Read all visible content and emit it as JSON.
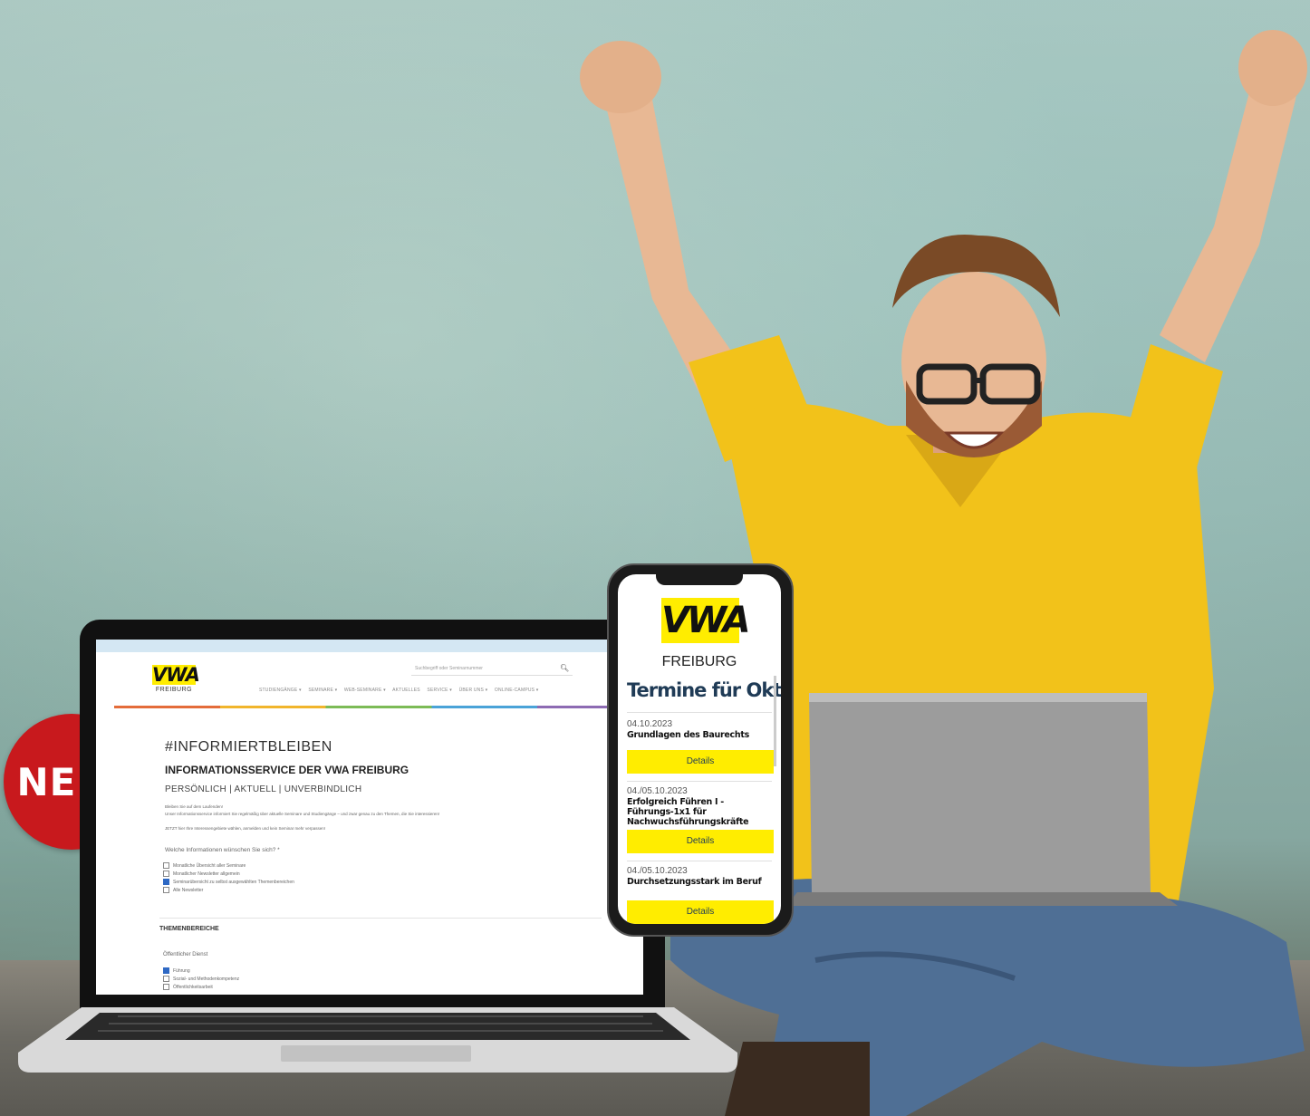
{
  "badge": {
    "text": "NEU!"
  },
  "laptop_site": {
    "logo_mark": "VWA",
    "logo_city": "FREIBURG",
    "search_placeholder": "Suchbegriff oder Seminarnummer",
    "nav": [
      "STUDIENGÄNGE ▾",
      "SEMINARE ▾",
      "WEB-SEMINARE ▾",
      "AKTUELLES",
      "SERVICE ▾",
      "ÜBER UNS ▾",
      "ONLINE-CAMPUS ▾"
    ],
    "hashtag": "#INFORMIERTBLEIBEN",
    "heading": "INFORMATIONSSERVICE DER VWA FREIBURG",
    "subheading": "PERSÖNLICH | AKTUELL | UNVERBINDLICH",
    "paragraphs": [
      "Bleiben Sie auf dem Laufenden!",
      "Unser Informationsservice informiert Sie regelmäßig über aktuelle Seminare und Studiengänge – und zwar genau zu den Themen, die Sie interessieren!",
      "JETZT hier Ihre Interessengebiete wählen, anmelden und kein Seminar mehr verpassen!"
    ],
    "question": "Welche Informationen wünschen Sie sich? *",
    "options": [
      {
        "label": "Monatliche Übersicht aller Seminare",
        "checked": false
      },
      {
        "label": "Monatlicher Newsletter allgemein",
        "checked": false
      },
      {
        "label": "Seminarübersicht zu selbst ausgewählten Themenbereichen",
        "checked": true
      },
      {
        "label": "Alle Newsletter",
        "checked": false
      }
    ],
    "section_title": "THEMENBEREICHE",
    "group_title": "Öffentlicher Dienst",
    "topics": [
      {
        "label": "Führung",
        "checked": true
      },
      {
        "label": "Sozial- und Methodenkompetenz",
        "checked": false
      },
      {
        "label": "Öffentlichkeitsarbeit",
        "checked": false
      }
    ]
  },
  "phone_site": {
    "logo_mark": "VWA",
    "logo_city": "FREIBURG",
    "title": "Termine für Oktober",
    "events": [
      {
        "date": "04.10.2023",
        "name": "Grundlagen des Baurechts",
        "button": "Details"
      },
      {
        "date": "04./05.10.2023",
        "name": "Erfolgreich Führen I - Führungs-1x1 für Nachwuchsführungskräfte",
        "button": "Details"
      },
      {
        "date": "04./05.10.2023",
        "name": "Durchsetzungsstark im Beruf",
        "button": "Details"
      }
    ]
  },
  "colors": {
    "brand_yellow": "#ffed00",
    "badge_red": "#c8191d",
    "shirt_yellow": "#f2c21a",
    "title_blue": "#1f3b56"
  }
}
